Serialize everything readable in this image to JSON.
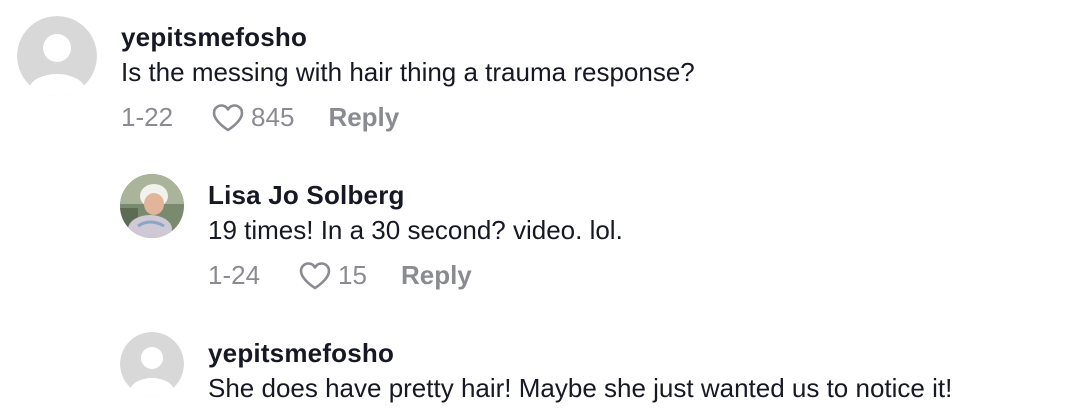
{
  "comments": [
    {
      "username": "yepitsmefosho",
      "text": "Is the messing with hair thing a trauma response?",
      "date": "1-22",
      "likes": "845",
      "reply_label": "Reply",
      "avatar": "default-avatar-icon"
    },
    {
      "username": "Lisa Jo Solberg",
      "text": "19 times! In a 30 second? video. lol.",
      "date": "1-24",
      "likes": "15",
      "reply_label": "Reply",
      "avatar": "user-photo"
    },
    {
      "username": "yepitsmefosho",
      "text": "She does have pretty hair! Maybe she just wanted us to notice it!",
      "avatar": "default-avatar-icon"
    }
  ],
  "colors": {
    "primary_text": "#161823",
    "secondary_text": "#8a8b91",
    "avatar_bg": "#d8d8d8"
  }
}
